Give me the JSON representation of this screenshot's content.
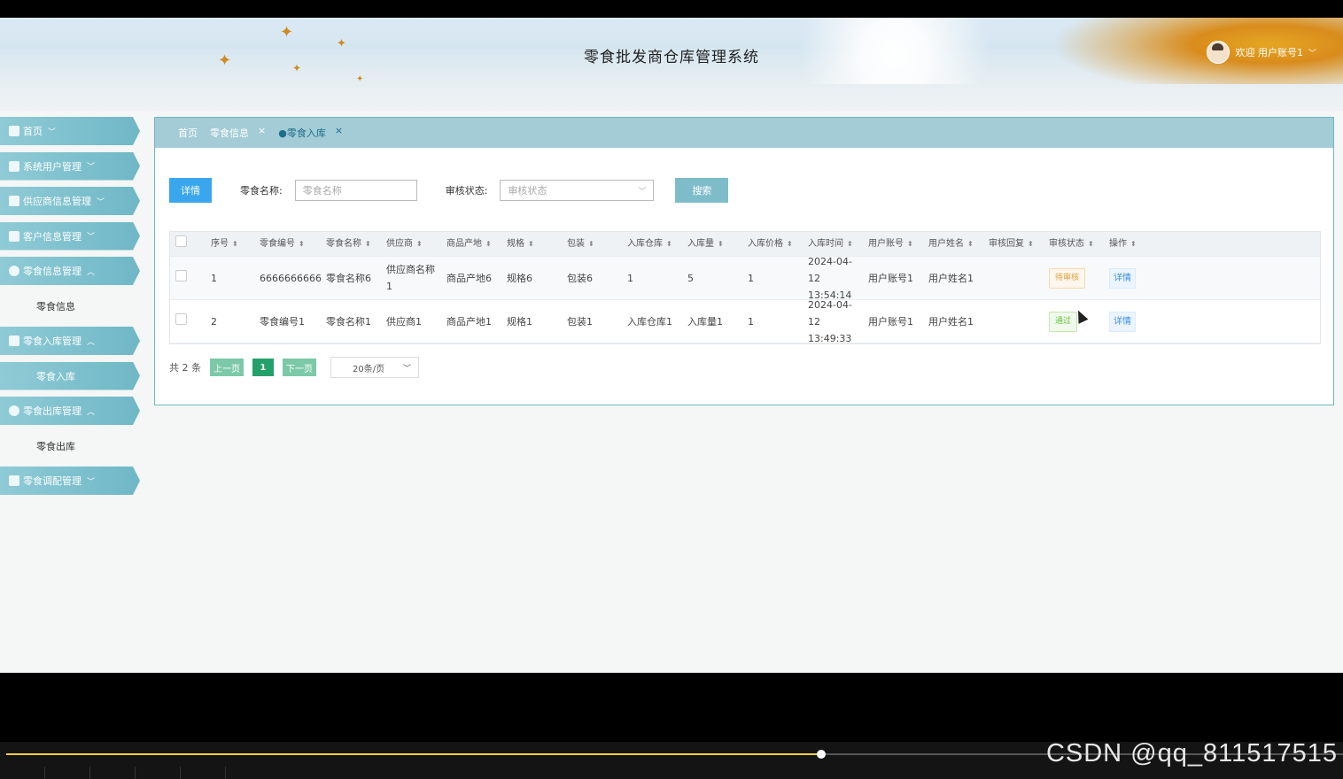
{
  "header": {
    "title": "零食批发商仓库管理系统",
    "welcome": "欢迎 用户账号1"
  },
  "sidebar": {
    "items": [
      {
        "label": "首页",
        "chev": "﹀"
      },
      {
        "label": "系统用户管理",
        "chev": "﹀"
      },
      {
        "label": "供应商信息管理",
        "chev": "﹀"
      },
      {
        "label": "客户信息管理",
        "chev": "﹀"
      },
      {
        "label": "零食信息管理",
        "chev": "︿"
      },
      {
        "label": "零食信息"
      },
      {
        "label": "零食入库管理",
        "chev": "︿"
      },
      {
        "label": "零食入库"
      },
      {
        "label": "零食出库管理",
        "chev": "︿"
      },
      {
        "label": "零食出库"
      },
      {
        "label": "零食调配管理",
        "chev": "﹀"
      }
    ]
  },
  "tabs": [
    {
      "label": "首页"
    },
    {
      "label": "零食信息",
      "close": "×"
    },
    {
      "label": "●零食入库",
      "close": "×"
    }
  ],
  "toolbar": {
    "detail_label": "详情",
    "name_label": "零食名称:",
    "name_placeholder": "零食名称",
    "status_label": "审核状态:",
    "status_placeholder": "审核状态",
    "search_label": "搜索"
  },
  "table": {
    "columns": [
      "序号",
      "零食编号",
      "零食名称",
      "供应商",
      "商品产地",
      "规格",
      "包装",
      "入库仓库",
      "入库量",
      "入库价格",
      "入库时间",
      "用户账号",
      "用户姓名",
      "审核回复",
      "审核状态",
      "操作"
    ],
    "rows": [
      {
        "no": "1",
        "code": "6666666666",
        "name": "零食名称6",
        "supplier": "供应商名称1",
        "origin": "商品产地6",
        "spec": "规格6",
        "pack": "包装6",
        "warehouse": "1",
        "qty": "5",
        "price": "1",
        "time": "2024-04-12 13:54:14",
        "account": "用户账号1",
        "username": "用户姓名1",
        "reply": "",
        "status": "待审核",
        "action": "详情"
      },
      {
        "no": "2",
        "code": "零食编号1",
        "name": "零食名称1",
        "supplier": "供应商1",
        "origin": "商品产地1",
        "spec": "规格1",
        "pack": "包装1",
        "warehouse": "入库仓库1",
        "qty": "入库量1",
        "price": "1",
        "time": "2024-04-12 13:49:33",
        "account": "用户账号1",
        "username": "用户姓名1",
        "reply": "",
        "status": "通过",
        "action": "详情"
      }
    ]
  },
  "pager": {
    "total": "共 2 条",
    "prev": "上一页",
    "current": "1",
    "next": "下一页",
    "size": "20条/页"
  },
  "player": {
    "progress": 0.61
  },
  "watermark": "CSDN @qq_811517515"
}
